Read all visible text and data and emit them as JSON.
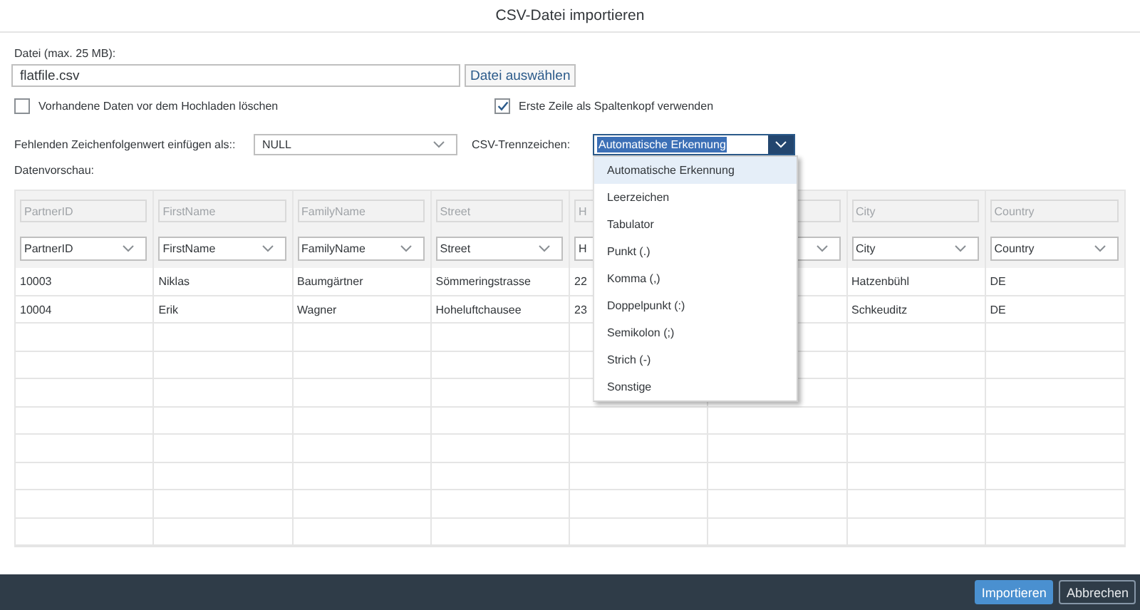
{
  "dialog": {
    "title": "CSV-Datei importieren"
  },
  "file": {
    "label": "Datei (max. 25 MB):",
    "value": "flatfile.csv",
    "button": "Datei auswählen"
  },
  "options": [
    {
      "label": "Vorhandene Daten vor dem Hochladen löschen",
      "checked": false
    },
    {
      "label": "Erste Zeile als Spaltenkopf verwenden",
      "checked": true
    }
  ],
  "missing_value": {
    "label": "Fehlenden Zeichenfolgenwert einfügen als::",
    "value": "NULL"
  },
  "separator": {
    "label": "CSV-Trennzeichen:",
    "value": "Automatische Erkennung",
    "expanded": true,
    "options": [
      {
        "label": "Automatische Erkennung",
        "selected": true
      },
      {
        "label": "Leerzeichen",
        "selected": false
      },
      {
        "label": "Tabulator",
        "selected": false
      },
      {
        "label": "Punkt (.)",
        "selected": false
      },
      {
        "label": "Komma (,)",
        "selected": false
      },
      {
        "label": "Doppelpunkt (:)",
        "selected": false
      },
      {
        "label": "Semikolon (;)",
        "selected": false
      },
      {
        "label": "Strich (-)",
        "selected": false
      },
      {
        "label": "Sonstige",
        "selected": false
      }
    ]
  },
  "preview": {
    "label": "Datenvorschau:",
    "columns": [
      {
        "source": "PartnerID",
        "target": "PartnerID",
        "values": [
          "10003",
          "10004"
        ]
      },
      {
        "source": "FirstName",
        "target": "FirstName",
        "values": [
          "Niklas",
          "Erik"
        ]
      },
      {
        "source": "FamilyName",
        "target": "FamilyName",
        "values": [
          "Baumgärtner",
          "Wagner"
        ]
      },
      {
        "source": "Street",
        "target": "Street",
        "values": [
          "Sömmeringstrasse",
          "Hoheluftchausee"
        ]
      },
      {
        "source": "H",
        "target": "H",
        "values": [
          "22",
          "23"
        ]
      },
      {},
      {
        "source": "City",
        "target": "City",
        "values": [
          "Hatzenbühl",
          "Schkeuditz"
        ]
      },
      {
        "source": "Country",
        "target": "Country",
        "values": [
          "DE",
          "DE"
        ]
      }
    ]
  },
  "footer": {
    "buttons": [
      {
        "label": "Importieren",
        "kind": "emphasized"
      },
      {
        "label": "Abbrechen",
        "kind": "transparent"
      }
    ]
  }
}
